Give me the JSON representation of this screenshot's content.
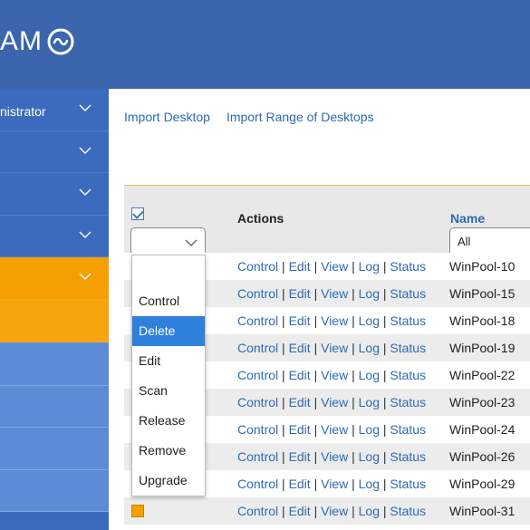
{
  "header": {
    "logo_text": "AM",
    "logo_icon": "wave-ring-icon",
    "background": "#3b66ae"
  },
  "sidebar": {
    "items": [
      {
        "label": "nistrator",
        "state": "normal"
      },
      {
        "label": "",
        "state": "normal"
      },
      {
        "label": "",
        "state": "normal"
      },
      {
        "label": "",
        "state": "normal"
      },
      {
        "label": "",
        "state": "active"
      },
      {
        "label": "",
        "state": "sub-active"
      },
      {
        "label": "",
        "state": "light"
      },
      {
        "label": "",
        "state": "light"
      },
      {
        "label": "",
        "state": "light"
      },
      {
        "label": "",
        "state": "light"
      }
    ],
    "accent": "#f5a000"
  },
  "links": {
    "import_desktop": "Import Desktop",
    "import_range": "Import Range of Desktops"
  },
  "table": {
    "columns": {
      "actions": "Actions",
      "name": "Name"
    },
    "name_filter": "All",
    "header_checked": true,
    "action_links": [
      "Control",
      "Edit",
      "View",
      "Log",
      "Status"
    ],
    "separator": "|",
    "rows": [
      {
        "name": "WinPool-10"
      },
      {
        "name": "WinPool-15"
      },
      {
        "name": "WinPool-18"
      },
      {
        "name": "WinPool-19"
      },
      {
        "name": "WinPool-22"
      },
      {
        "name": "WinPool-23"
      },
      {
        "name": "WinPool-24"
      },
      {
        "name": "WinPool-26"
      },
      {
        "name": "WinPool-29"
      },
      {
        "name": "WinPool-31"
      }
    ]
  },
  "bulk_dropdown": {
    "options": [
      "",
      "Control",
      "Delete",
      "Edit",
      "Scan",
      "Release",
      "Remove",
      "Upgrade"
    ],
    "highlighted": "Delete",
    "highlight_color": "#2f7fdc"
  }
}
